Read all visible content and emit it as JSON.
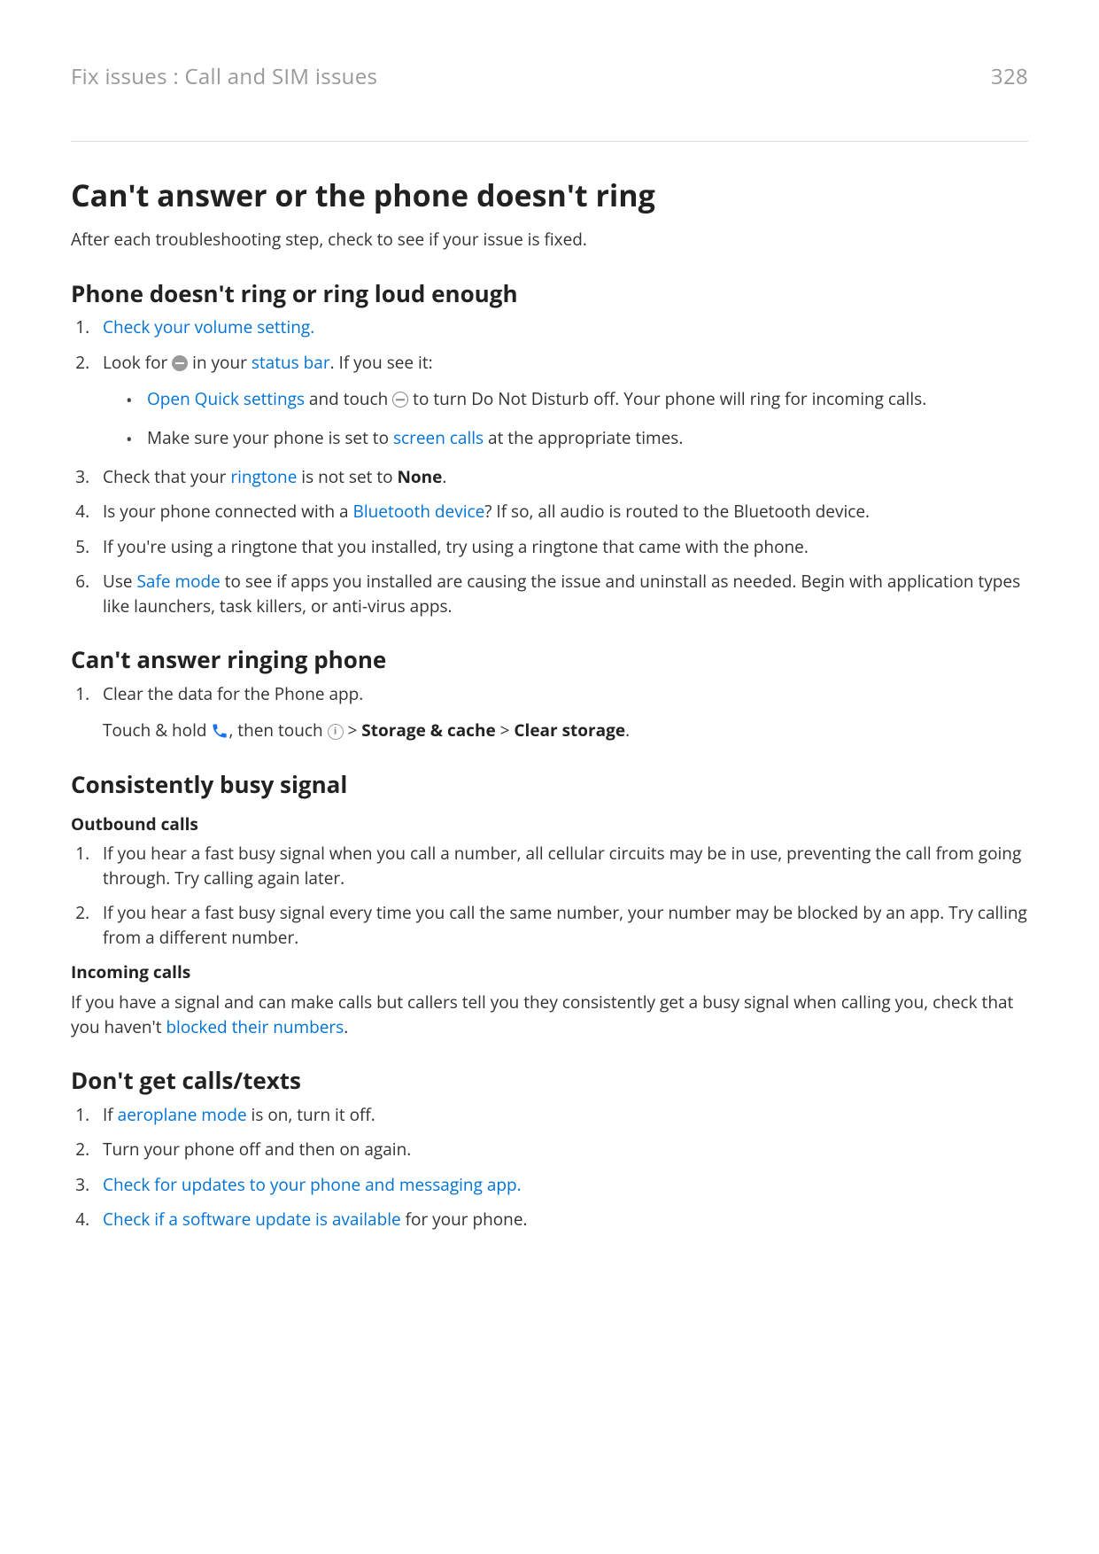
{
  "header": {
    "breadcrumb": "Fix issues : Call and SIM issues",
    "page": "328"
  },
  "title": "Can't answer or the phone doesn't ring",
  "intro": "After each troubleshooting step, check to see if your issue is fixed.",
  "s1": {
    "heading": "Phone doesn't ring or ring loud enough",
    "i1": "Check your volume setting.",
    "i2a": "Look for ",
    "i2b": " in your ",
    "i2_link": "status bar",
    "i2c": ". If you see it:",
    "b1a": "Open Quick settings",
    "b1b": " and touch ",
    "b1c": " to turn Do Not Disturb off. Your phone will ring for incoming calls.",
    "b2a": "Make sure your phone is set to ",
    "b2_link": "screen calls",
    "b2b": " at the appropriate times.",
    "i3a": "Check that your ",
    "i3_link": "ringtone",
    "i3b": " is not set to ",
    "i3_bold": "None",
    "i3c": ".",
    "i4a": "Is your phone connected with a ",
    "i4_link": "Bluetooth device",
    "i4b": "? If so, all audio is routed to the Bluetooth device.",
    "i5": "If you're using a ringtone that you installed, try using a ringtone that came with the phone.",
    "i6a": "Use ",
    "i6_link": "Safe mode",
    "i6b": " to see if apps you installed are causing the issue and uninstall as needed. Begin with application types like launchers, task killers, or anti-virus apps."
  },
  "s2": {
    "heading": "Can't answer ringing phone",
    "i1": "Clear the data for the Phone app.",
    "p1a": "Touch & hold ",
    "p1b": ", then touch ",
    "p1c": " > ",
    "p1_bold1": "Storage & cache",
    "p1d": " > ",
    "p1_bold2": "Clear storage",
    "p1e": "."
  },
  "s3": {
    "heading": "Consistently busy signal",
    "sub1": "Outbound calls",
    "i1": "If you hear a fast busy signal when you call a number, all cellular circuits may be in use, preventing the call from going through. Try calling again later.",
    "i2": "If you hear a fast busy signal every time you call the same number, your number may be blocked by an app. Try calling from a different number.",
    "sub2": "Incoming calls",
    "p2a": "If you have a signal and can make calls but callers tell you they consistently get a busy signal when calling you, check that you haven't ",
    "p2_link": "blocked their numbers",
    "p2b": "."
  },
  "s4": {
    "heading": "Don't get calls/texts",
    "i1a": "If ",
    "i1_link": "aeroplane mode",
    "i1b": " is on, turn it off.",
    "i2": "Turn your phone off and then on again.",
    "i3": "Check for updates to your phone and messaging app.",
    "i4_link": "Check if a software update is available",
    "i4b": " for your phone."
  }
}
